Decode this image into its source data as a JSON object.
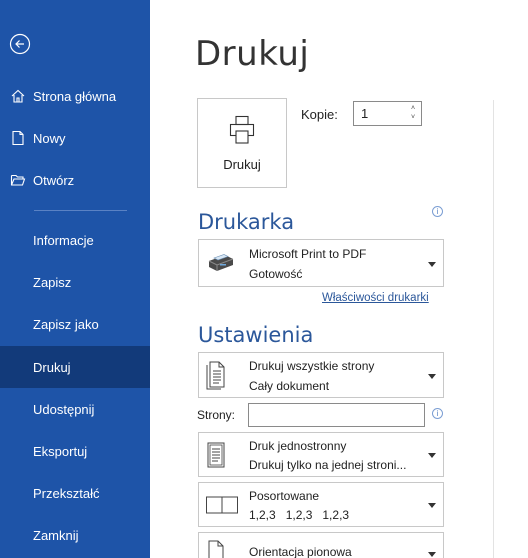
{
  "sidebar": {
    "back": "back-arrow",
    "items": [
      {
        "label": "Strona główna",
        "icon": "home-icon"
      },
      {
        "label": "Nowy",
        "icon": "new-document-icon"
      },
      {
        "label": "Otwórz",
        "icon": "open-folder-icon"
      },
      {
        "label": "Informacje"
      },
      {
        "label": "Zapisz"
      },
      {
        "label": "Zapisz jako"
      },
      {
        "label": "Drukuj",
        "active": true
      },
      {
        "label": "Udostępnij"
      },
      {
        "label": "Eksportuj"
      },
      {
        "label": "Przekształć"
      },
      {
        "label": "Zamknij"
      }
    ],
    "bg_color": "#1e54a8",
    "active_color": "#123a7a"
  },
  "main": {
    "title": "Drukuj",
    "print_button_label": "Drukuj",
    "copies_label": "Kopie:",
    "copies_value": "1",
    "printer_section_title": "Drukarka",
    "printer": {
      "name": "Microsoft Print to PDF",
      "status": "Gotowość"
    },
    "printer_properties_link": "Właściwości drukarki",
    "settings_section_title": "Ustawienia",
    "settings": {
      "pages_scope": {
        "line1": "Drukuj wszystkie strony",
        "line2": "Cały dokument"
      },
      "pages_label": "Strony:",
      "pages_value": "",
      "sides": {
        "line1": "Druk jednostronny",
        "line2": "Drukuj tylko na jednej stroni..."
      },
      "collation": {
        "line1": "Posortowane",
        "line2": "1,2,3   1,2,3   1,2,3"
      },
      "orientation": {
        "line1": "Orientacja pionowa"
      }
    },
    "accent_color": "#2b579a"
  }
}
